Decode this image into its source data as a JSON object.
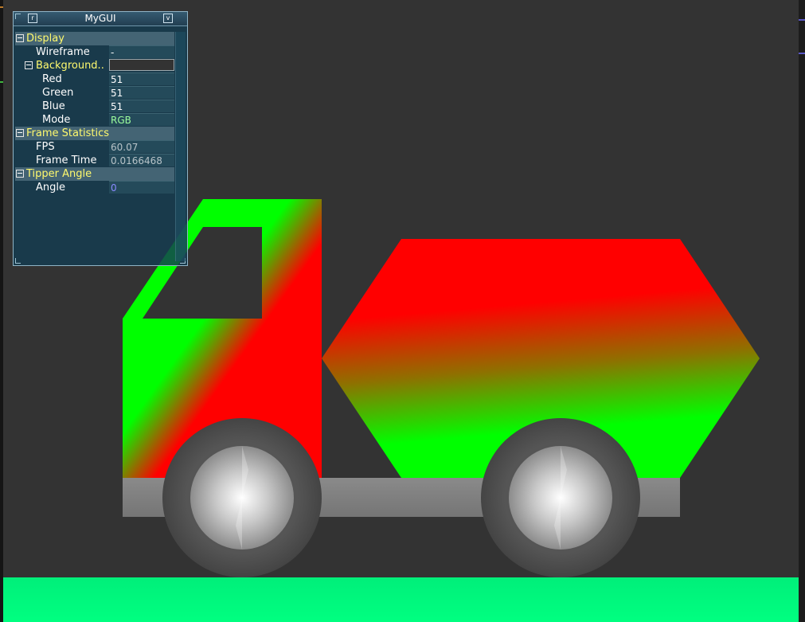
{
  "window": {
    "title": "MyGUI",
    "left_button_glyph": "r",
    "right_button_glyph": "v"
  },
  "sections": {
    "display": {
      "label": "Display",
      "wireframe": {
        "label": "Wireframe",
        "value": "-"
      },
      "background": {
        "label": "Background..",
        "swatch_color": "#333333",
        "red": {
          "label": "Red",
          "value": "51"
        },
        "green": {
          "label": "Green",
          "value": "51"
        },
        "blue": {
          "label": "Blue",
          "value": "51"
        },
        "mode": {
          "label": "Mode",
          "value": "RGB"
        }
      }
    },
    "frame_statistics": {
      "label": "Frame Statistics",
      "fps": {
        "label": "FPS",
        "value": "60.07"
      },
      "frame_time": {
        "label": "Frame Time",
        "value": "0.0166468"
      }
    },
    "tipper_angle": {
      "label": "Tipper Angle",
      "angle": {
        "label": "Angle",
        "value": "0"
      }
    }
  },
  "icons": {
    "collapse": "minus-box-icon",
    "window_left": "restore-icon",
    "window_right": "chevron-down-icon"
  },
  "colors": {
    "background": "#333333",
    "ground": "#00ff80",
    "truck_red": "#ff0000",
    "truck_green": "#00ff00",
    "chassis": "#808080",
    "tire": "#4a4a4a",
    "section_text": "#fffa6e"
  }
}
